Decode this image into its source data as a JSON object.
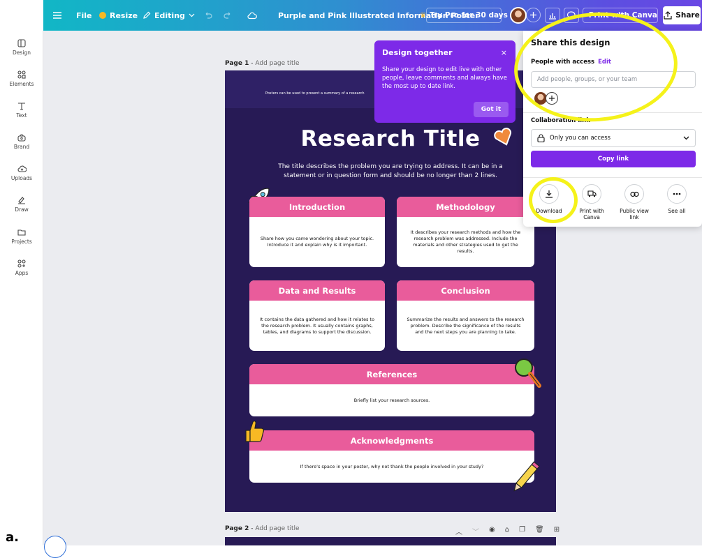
{
  "topbar": {
    "file": "File",
    "resize": "Resize",
    "editing": "Editing",
    "doc_title": "Purple and Pink Illustrated Information Poster",
    "try_pro": "Try Pro for 30 days",
    "print": "Print with Canva",
    "share": "Share"
  },
  "rail": {
    "items": [
      "Design",
      "Elements",
      "Text",
      "Brand",
      "Uploads",
      "Draw",
      "Projects",
      "Apps"
    ]
  },
  "pages": {
    "page1_label": "Page 1",
    "page1_sub": "Add page title",
    "page2_label": "Page 2",
    "page2_sub": "Add page title"
  },
  "poster": {
    "intro": "Posters can be used to present a summary of a research",
    "title": "Research Title",
    "desc": "The title describes the problem you are trying to address. It can be in a statement or in question form and should be no longer than 2 lines.",
    "cards": [
      {
        "title": "Introduction",
        "body": "Share how you came wondering about your topic. Introduce it and explain why is it important."
      },
      {
        "title": "Methodology",
        "body": "It describes your research methods and how the research problem was addressed. Include the materials and other strategies used to get the results."
      },
      {
        "title": "Data and Results",
        "body": "It contains the data gathered and how it relates to the research problem. It usually contains graphs, tables, and diagrams to support the discussion."
      },
      {
        "title": "Conclusion",
        "body": "Summarize the results and answers to the research problem. Describe the significance of the results and the next steps you are planning to take."
      },
      {
        "title": "References",
        "body": "Briefly list your research sources."
      },
      {
        "title": "Acknowledgments",
        "body": "If there's space in your poster, why not thank the people involved in your study?"
      }
    ]
  },
  "tooltip": {
    "title": "Design together",
    "close": "×",
    "body": "Share your design to edit live with other people, leave comments and always have the most up to date link.",
    "button": "Got it"
  },
  "share": {
    "title": "Share this design",
    "people_label": "People with access",
    "edit": "Edit",
    "input_placeholder": "Add people, groups, or your team",
    "collab_label": "Collaboration link",
    "access": "Only you can access",
    "copy": "Copy link",
    "options": [
      {
        "label": "Download"
      },
      {
        "label": "Print with Canva"
      },
      {
        "label": "Public view link"
      },
      {
        "label": "See all"
      }
    ]
  },
  "footnote": "a."
}
